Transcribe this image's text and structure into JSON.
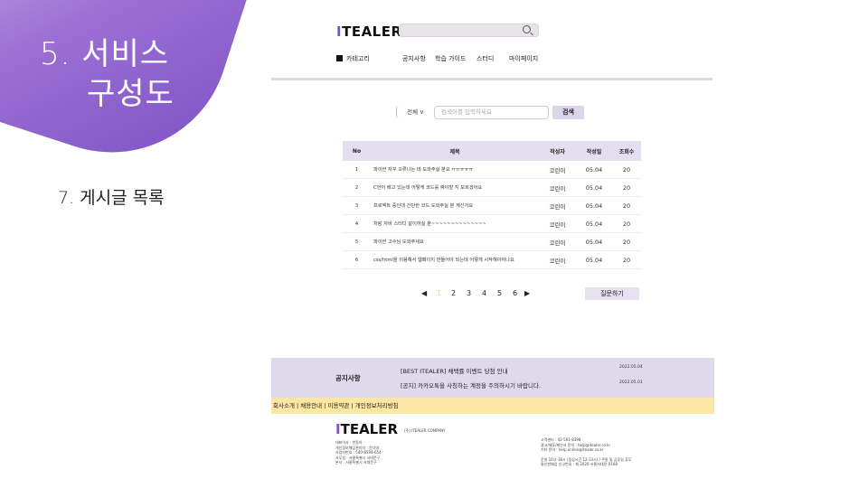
{
  "slide": {
    "title_line1": "5. 서비스",
    "title_line2": "구성도",
    "subtitle": "7. 게시글 목록"
  },
  "header": {
    "logo_prefix": "I",
    "logo_rest": "TEALER",
    "search_icon": "search-icon"
  },
  "nav": {
    "category": "카테고리",
    "items": [
      "공지사항",
      "학습 가이드",
      "스터디",
      "마이페이지"
    ]
  },
  "filter": {
    "select_value": "전체 ∨",
    "placeholder": "검색어를 입력하세요",
    "search_label": "검색"
  },
  "table": {
    "columns": [
      "No",
      "제목",
      "작성자",
      "작성일",
      "조회수"
    ],
    "rows": [
      {
        "no": "1",
        "title": "파이썬 자꾸 오류나는 데 도와주실 분요 ㅠㅠㅠㅠㅠ",
        "author": "코린이",
        "date": "05.04",
        "views": "20"
      },
      {
        "no": "2",
        "title": "C언어 배고 있는데 어떻게 코드를 짜야할 지 모르겠어요",
        "author": "코린이",
        "date": "05.04",
        "views": "20"
      },
      {
        "no": "3",
        "title": "프로젝트 중인데 간단한 코드 도와주실 분 계신가요",
        "author": "코린이",
        "date": "05.04",
        "views": "20"
      },
      {
        "no": "4",
        "title": "저랑 자바 스터디 같이하실 분~~~~~~~~~~~~~~",
        "author": "코린이",
        "date": "05.04",
        "views": "20"
      },
      {
        "no": "5",
        "title": "파이썬 고수님 도와주세요",
        "author": "코린이",
        "date": "05.04",
        "views": "20"
      },
      {
        "no": "6",
        "title": "css/html을 이용해서 웹페이지 만들어야 되는데 어떻게 시작해야하나요",
        "author": "코린이",
        "date": "05.04",
        "views": "20"
      }
    ]
  },
  "pagination": {
    "prev": "◀",
    "pages": [
      "1",
      "2",
      "3",
      "4",
      "5",
      "6"
    ],
    "next": "▶",
    "ask_label": "질문하기"
  },
  "notice": {
    "label": "공지사항",
    "items": [
      {
        "text": "[BEST ITEALER] 채택률 이벤트 당첨 안내",
        "date": "2022.05.04"
      },
      {
        "text": "[공지] 카카오톡을 사칭하는 계정을 주의하시기 바랍니다.",
        "date": "2022.05.01"
      }
    ]
  },
  "footer": {
    "links": "회사소개 | 채용안내 | 이용약관 | 개인정보처리방침",
    "company": "(주) ITEALER COMPANY",
    "left_lines": [
      "대표이사 : 한동아",
      "개인정보책임관리자 : 윤다영",
      "사업자번호 : 540-8594-654",
      "사무실 : 서울특별시 서대문구",
      "본사 : 서울특별시 서대문구"
    ],
    "right_lines_1": [
      "고객센터 : 02-561-8398",
      "광고/제휴/제안서 문의 : help@itealer.co.kr",
      "기타 문의 : help.online@itealer.co.kr"
    ],
    "right_lines_2": [
      "운영 10시-18시 (점심시간 12-13시) / 주말 및 공휴일 휴무",
      "통신판매업 신고번호 : 제 2020-서울서대문-0148"
    ]
  },
  "colors": {
    "accent": "#7d52c4",
    "table_header": "#e3dfee",
    "notice_bg": "#dedaeb",
    "footer_links_bg": "#fbe6a6"
  }
}
